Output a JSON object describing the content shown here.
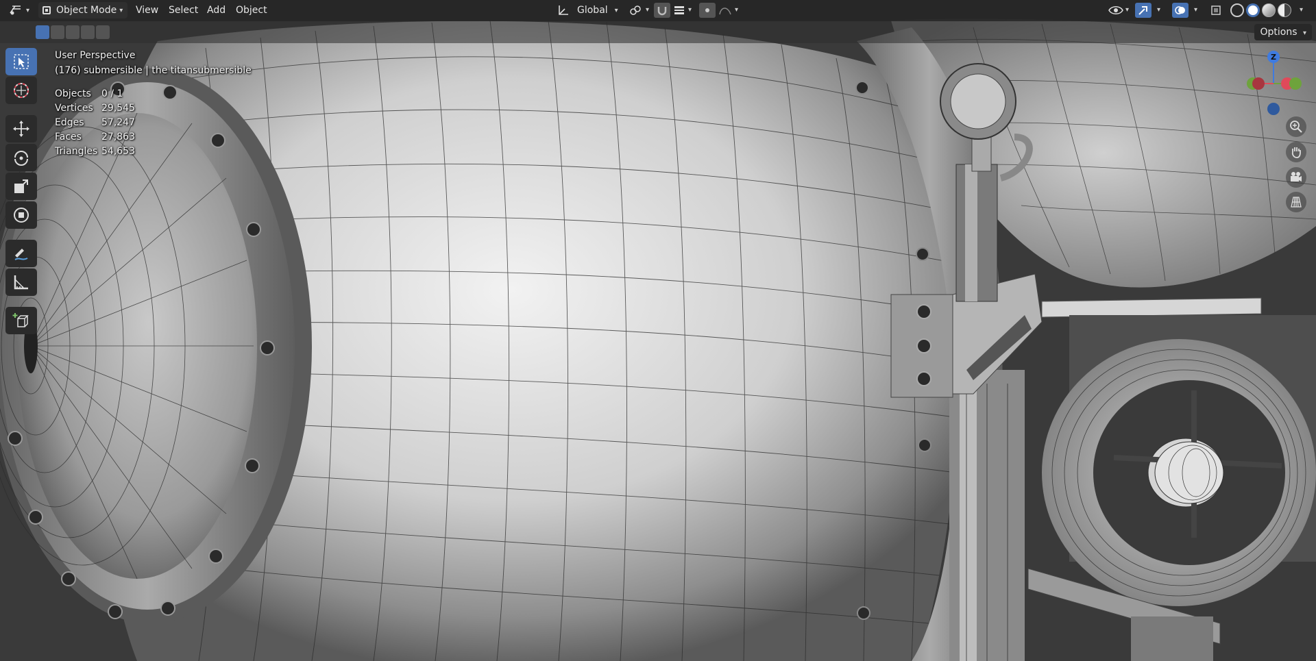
{
  "header": {
    "mode_label": "Object Mode",
    "menus": [
      "View",
      "Select",
      "Add",
      "Object"
    ],
    "transform_orientation": "Global"
  },
  "tool_settings": {
    "options_label": "Options"
  },
  "viewport": {
    "view_name": "User Perspective",
    "object_info": "(176) submersible | the titansubmersible",
    "stats": [
      {
        "label": "Objects",
        "value": "0 / 1"
      },
      {
        "label": "Vertices",
        "value": "29,545"
      },
      {
        "label": "Edges",
        "value": "57,247"
      },
      {
        "label": "Faces",
        "value": "27,863"
      },
      {
        "label": "Triangles",
        "value": "54,653"
      }
    ]
  },
  "gizmo": {
    "z_label": "Z",
    "colors": {
      "x": "#e04a5a",
      "y": "#6ea33c",
      "z": "#3f7be0"
    }
  },
  "colors": {
    "accent": "#4772b3",
    "header_bg": "#262626"
  }
}
